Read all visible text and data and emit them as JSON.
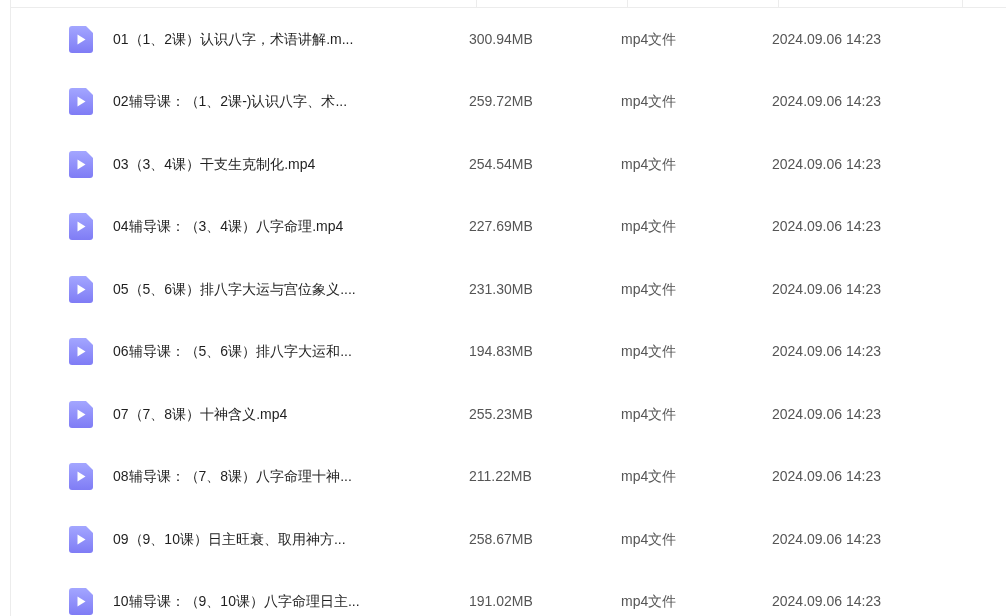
{
  "files": [
    {
      "name": "01（1、2课）认识八字，术语讲解.m...",
      "size": "300.94MB",
      "type": "mp4文件",
      "modified": "2024.09.06 14:23"
    },
    {
      "name": "02辅导课：（1、2课-)认识八字、术...",
      "size": "259.72MB",
      "type": "mp4文件",
      "modified": "2024.09.06 14:23"
    },
    {
      "name": "03（3、4课）干支生克制化.mp4",
      "size": "254.54MB",
      "type": "mp4文件",
      "modified": "2024.09.06 14:23"
    },
    {
      "name": "04辅导课：（3、4课）八字命理.mp4",
      "size": "227.69MB",
      "type": "mp4文件",
      "modified": "2024.09.06 14:23"
    },
    {
      "name": "05（5、6课）排八字大运与宫位象义....",
      "size": "231.30MB",
      "type": "mp4文件",
      "modified": "2024.09.06 14:23"
    },
    {
      "name": "06辅导课：（5、6课）排八字大运和...",
      "size": "194.83MB",
      "type": "mp4文件",
      "modified": "2024.09.06 14:23"
    },
    {
      "name": "07（7、8课）十神含义.mp4",
      "size": "255.23MB",
      "type": "mp4文件",
      "modified": "2024.09.06 14:23"
    },
    {
      "name": "08辅导课：（7、8课）八字命理十神...",
      "size": "211.22MB",
      "type": "mp4文件",
      "modified": "2024.09.06 14:23"
    },
    {
      "name": "09（9、10课）日主旺衰、取用神方...",
      "size": "258.67MB",
      "type": "mp4文件",
      "modified": "2024.09.06 14:23"
    },
    {
      "name": "10辅导课：（9、10课）八字命理日主...",
      "size": "191.02MB",
      "type": "mp4文件",
      "modified": "2024.09.06 14:23"
    }
  ]
}
